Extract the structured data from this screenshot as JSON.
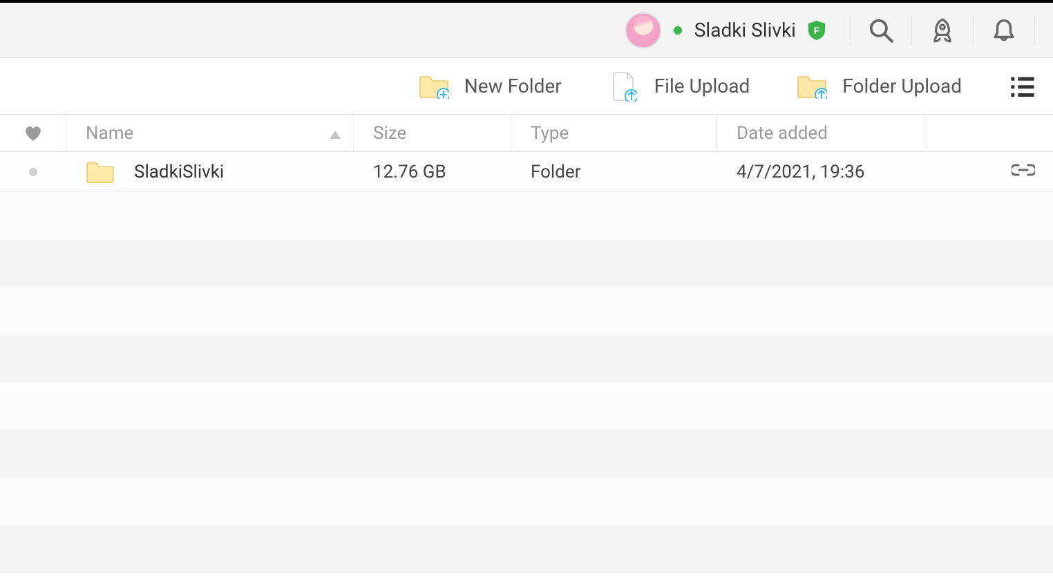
{
  "header": {
    "username": "Sladki Slivki",
    "status": "online",
    "plan_badge": "F"
  },
  "actions": {
    "new_folder": "New Folder",
    "file_upload": "File Upload",
    "folder_upload": "Folder Upload"
  },
  "columns": {
    "name": "Name",
    "size": "Size",
    "type": "Type",
    "date_added": "Date added"
  },
  "items": [
    {
      "name": "SladkiSlivki",
      "size": "12.76 GB",
      "type": "Folder",
      "date_added": "4/7/2021, 19:36"
    }
  ],
  "colors": {
    "accent_green": "#39b54a",
    "folder_fill": "#ffe9a8",
    "folder_stroke": "#e6c766",
    "upload_arrow": "#3fb9e8"
  }
}
